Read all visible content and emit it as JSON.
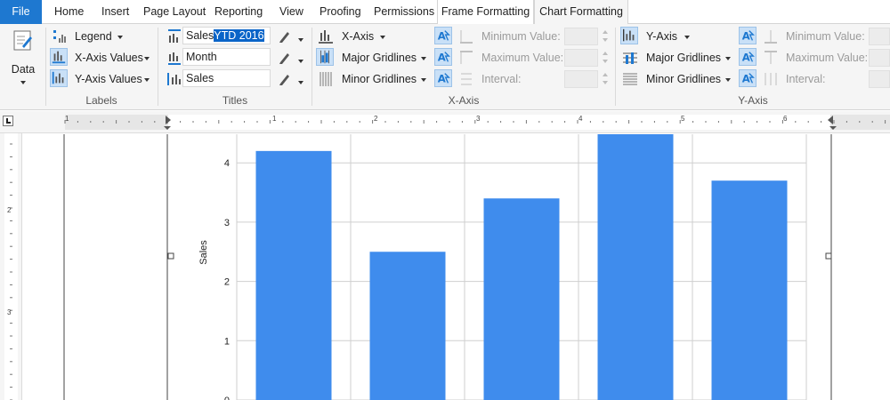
{
  "tabs": [
    {
      "label": "File"
    },
    {
      "label": "Home"
    },
    {
      "label": "Insert"
    },
    {
      "label": "Page Layout"
    },
    {
      "label": "Reporting"
    },
    {
      "label": "View"
    },
    {
      "label": "Proofing"
    },
    {
      "label": "Permissions"
    },
    {
      "label": "Frame Formatting"
    },
    {
      "label": "Chart Formatting"
    }
  ],
  "ribbon": {
    "data": {
      "label": "Data"
    },
    "labels_group": {
      "title": "Labels",
      "legend": "Legend",
      "x_axis_values": "X-Axis Values",
      "y_axis_values": "Y-Axis Values"
    },
    "titles_group": {
      "title": "Titles",
      "chart_title_plain": "Sales",
      "chart_title_selected": "YTD 2016",
      "x_title": "Month",
      "y_title": "Sales"
    },
    "xaxis_group": {
      "title": "X-Axis",
      "axis": "X-Axis",
      "major": "Major Gridlines",
      "minor": "Minor Gridlines",
      "min": "Minimum Value:",
      "max": "Maximum Value:",
      "interval": "Interval:"
    },
    "yaxis_group": {
      "title": "Y-Axis",
      "axis": "Y-Axis",
      "major": "Major Gridlines",
      "minor": "Minor Gridlines",
      "min": "Minimum Value:",
      "max": "Maximum Value:",
      "interval": "Interval:"
    }
  },
  "ruler": {
    "h_numbers": [
      "1",
      "1",
      "2",
      "3",
      "4",
      "5",
      "6"
    ],
    "v_numbers": [
      "2",
      "3"
    ]
  },
  "chart_data": {
    "type": "bar",
    "ylabel": "Sales",
    "ylim": [
      0,
      4.5
    ],
    "yticks": [
      0,
      1,
      2,
      3,
      4
    ],
    "values": [
      4.2,
      2.5,
      3.4,
      4.5,
      3.7
    ],
    "bar_color": "#3f8ced",
    "grid": true
  },
  "colors": {
    "file_tab": "#1e78d0",
    "selection": "#0a64c8",
    "icon_highlight": "#c9e0f7"
  }
}
